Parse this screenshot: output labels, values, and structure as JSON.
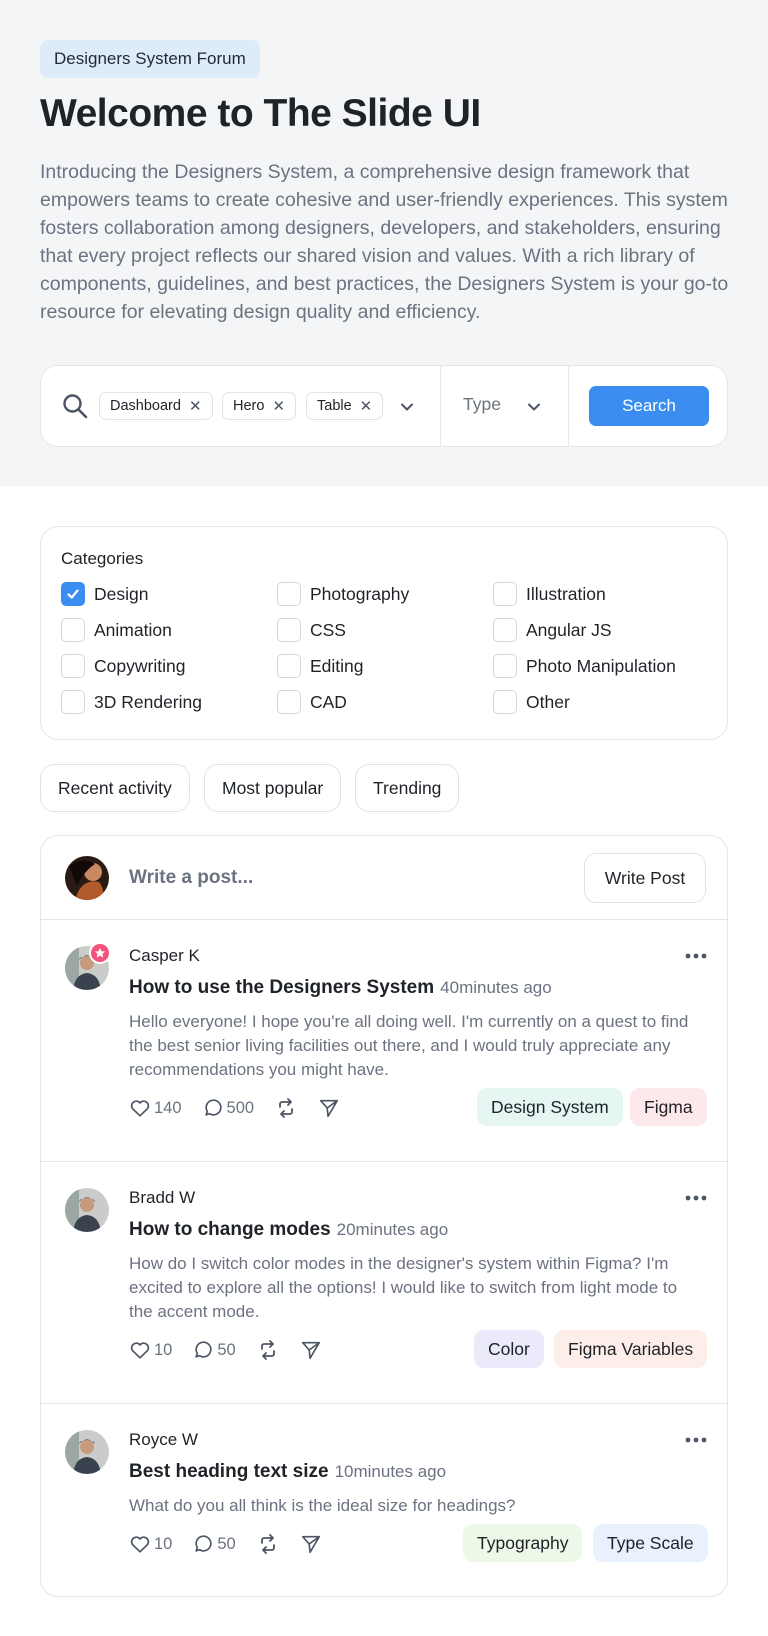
{
  "hero": {
    "badge": "Designers System Forum",
    "title": "Welcome to The Slide UI",
    "description": "Introducing the Designers System, a comprehensive design framework that empowers teams to create cohesive and user-friendly experiences. This system fosters collaboration among designers, developers, and stakeholders, ensuring that every project reflects our shared vision and values. With a rich library of components, guidelines, and best practices, the Designers System is your go-to resource for elevating design quality and efficiency."
  },
  "search": {
    "chips": [
      "Dashboard",
      "Hero",
      "Table"
    ],
    "type_placeholder": "Type",
    "button_label": "Search"
  },
  "categories": {
    "title": "Categories",
    "items": [
      {
        "label": "Design",
        "checked": true
      },
      {
        "label": "Photography",
        "checked": false
      },
      {
        "label": "Illustration",
        "checked": false
      },
      {
        "label": "Animation",
        "checked": false
      },
      {
        "label": "CSS",
        "checked": false
      },
      {
        "label": "Angular JS",
        "checked": false
      },
      {
        "label": "Copywriting",
        "checked": false
      },
      {
        "label": "Editing",
        "checked": false
      },
      {
        "label": "Photo Manipulation",
        "checked": false
      },
      {
        "label": "3D Rendering",
        "checked": false
      },
      {
        "label": "CAD",
        "checked": false
      },
      {
        "label": "Other",
        "checked": false
      }
    ]
  },
  "filters": [
    "Recent activity",
    "Most popular",
    "Trending"
  ],
  "compose": {
    "placeholder": "Write a post...",
    "button_label": "Write Post"
  },
  "posts": [
    {
      "author": "Casper K",
      "title": "How to use the Designers System",
      "time": "40minutes ago",
      "body": "Hello everyone! I hope you're all doing well. I'm currently on a quest to find the best senior living facilities out there, and I would truly appreciate any recommendations you might have.",
      "likes": "140",
      "comments": "500",
      "tags": [
        {
          "label": "Design System",
          "color": "#e6f7f3"
        },
        {
          "label": "Figma",
          "color": "#fde8ec"
        }
      ]
    },
    {
      "author": "Bradd W",
      "title": "How to change modes",
      "time": "20minutes ago",
      "body": "How do I switch color modes in the designer's system within Figma? I'm excited to explore all the options! I would like to switch from light mode to the accent mode.",
      "likes": "10",
      "comments": "50",
      "tags": [
        {
          "label": "Color",
          "color": "#ebeafb"
        },
        {
          "label": "Figma Variables",
          "color": "#fdeee9"
        }
      ]
    },
    {
      "author": "Royce W",
      "title": "Best heading text size",
      "time": "10minutes ago",
      "body": "What do you all think is the ideal size for headings?",
      "likes": "10",
      "comments": "50",
      "tags": [
        {
          "label": "Typography",
          "color": "#eef8e8"
        },
        {
          "label": "Type Scale",
          "color": "#e8f1fc"
        }
      ]
    }
  ],
  "colors": {
    "accent": "#3b8ef0",
    "hero_bg": "#f4f5f7",
    "star_badge": "#f4517c"
  },
  "icons": [
    "search-icon",
    "close-icon",
    "chevron-down-icon",
    "checkmark-icon",
    "heart-icon",
    "comment-icon",
    "repost-icon",
    "send-icon",
    "more-dots-icon",
    "star-icon"
  ]
}
